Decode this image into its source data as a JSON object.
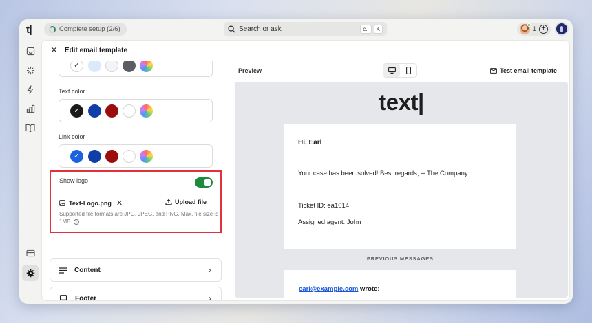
{
  "topbar": {
    "logo": "t|",
    "setup_label": "Complete setup (2/6)",
    "search_placeholder": "Search or ask",
    "search_kbd": [
      "c..",
      "K"
    ],
    "avatar_count": "1"
  },
  "panel": {
    "title": "Edit email template"
  },
  "settings": {
    "text_color_label": "Text color",
    "link_color_label": "Link color",
    "top_swatches": [
      "#ffffff",
      "#dbe9fb",
      "#f3f4f6",
      "#5a5d63",
      "rainbow"
    ],
    "text_swatches": [
      "#1a1a1a",
      "#0f3ea8",
      "#9b0c0c",
      "#ffffff",
      "rainbow"
    ],
    "link_swatches": [
      "#1a62e0",
      "#0f3ea8",
      "#9b0c0c",
      "#ffffff",
      "rainbow"
    ],
    "show_logo_label": "Show logo",
    "show_logo_on": true,
    "file_name": "Text-Logo.png",
    "upload_label": "Upload file",
    "hint": "Supported file formats are JPG, JPEG, and PNG. Max. file size is 1MB.",
    "content_label": "Content",
    "footer_label": "Footer"
  },
  "preview": {
    "title": "Preview",
    "test_label": "Test email template",
    "brand": "text|",
    "greeting": "Hi, Earl",
    "body": "Your case has been solved! Best regards, -- The Company",
    "ticket": "Ticket ID: ea1014",
    "agent": "Assigned agent: John",
    "previous_messages": "PREVIOUS MESSAGES:",
    "quote_email": "earl@example.com",
    "quote_suffix": " wrote:"
  },
  "colors": {
    "accent_toggle": "#1e8a3e",
    "highlight_border": "#e0313d"
  }
}
